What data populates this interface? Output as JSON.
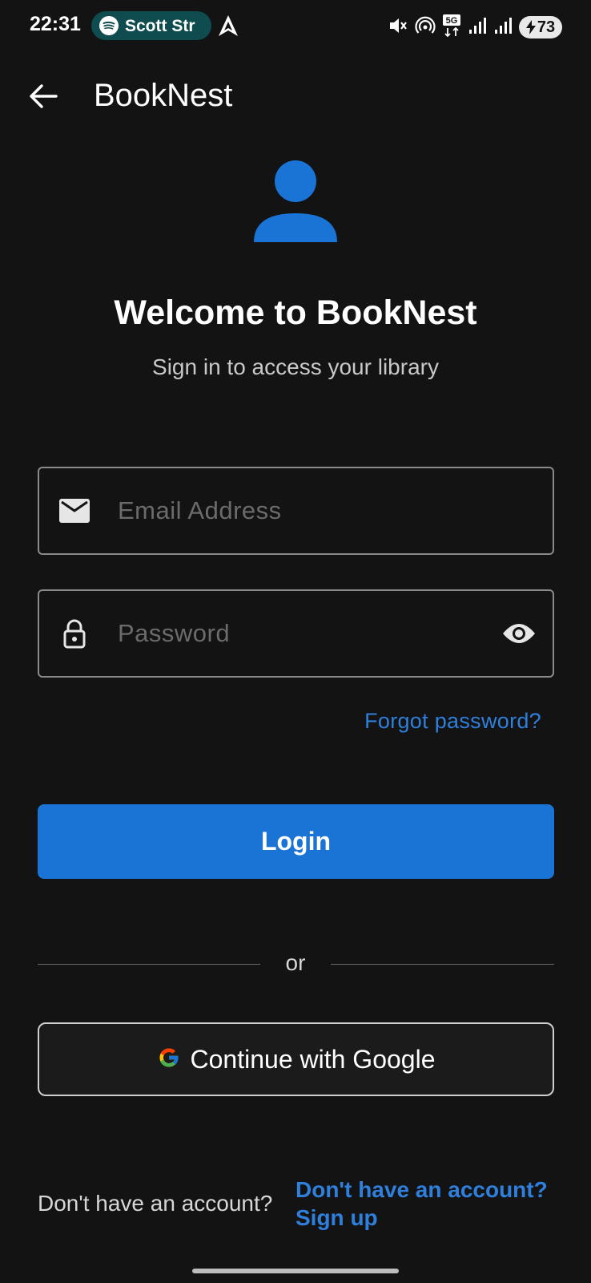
{
  "status_bar": {
    "time": "22:31",
    "spotify_text": "Scott Str",
    "battery": "73",
    "network_label": "5G",
    "icons": [
      "spotify-icon",
      "nav-arrow-icon",
      "mute-icon",
      "hotspot-icon",
      "5g-icon",
      "signal-icon",
      "signal-icon",
      "battery-icon"
    ]
  },
  "app_bar": {
    "title": "BookNest",
    "back_icon": "arrow-left-icon"
  },
  "header": {
    "avatar_icon": "person-icon",
    "welcome": "Welcome to BookNest",
    "subtitle": "Sign in to access your library"
  },
  "form": {
    "email_placeholder": "Email Address",
    "email_icon": "mail-icon",
    "password_placeholder": "Password",
    "password_icon": "lock-icon",
    "visibility_icon": "eye-icon",
    "forgot": "Forgot password?",
    "login": "Login"
  },
  "divider": {
    "or": "or"
  },
  "google": {
    "label": "Continue with Google",
    "icon": "google-icon"
  },
  "footer": {
    "prompt": "Don't have an account?",
    "link_line1": "Don't have an account?",
    "link_line2": "Sign up"
  },
  "colors": {
    "background": "#131313",
    "accent": "#1a74d6",
    "link": "#2f7fdc"
  }
}
